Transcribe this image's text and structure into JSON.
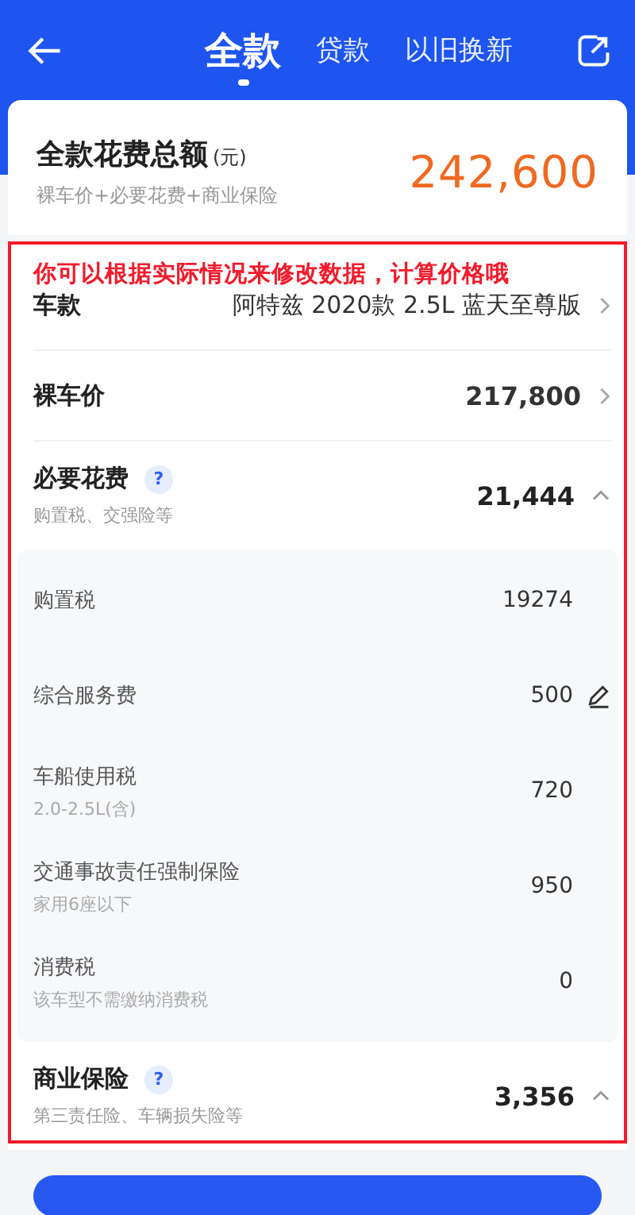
{
  "header": {
    "tabs": [
      {
        "label": "全款",
        "selected": true
      },
      {
        "label": "贷款",
        "selected": false
      },
      {
        "label": "以旧换新",
        "selected": false
      }
    ]
  },
  "summary": {
    "title": "全款花费总额",
    "unit": "(元)",
    "formula": "裸车价+必要花费+商业保险",
    "amount": "242,600"
  },
  "annotation": "你可以根据实际情况来修改数据，计算价格哦",
  "rows": [
    {
      "kind": "link",
      "label": "车款",
      "value": "阿特兹 2020款 2.5L 蓝天至尊版"
    },
    {
      "kind": "link",
      "label": "裸车价",
      "value": "217,800"
    },
    {
      "kind": "group",
      "label": "必要花费",
      "help": "?",
      "note": "购置税、交强险等",
      "value": "21,444",
      "expanded": true,
      "items": [
        {
          "label": "购置税",
          "value": "19274",
          "editable": false
        },
        {
          "label": "综合服务费",
          "value": "500",
          "editable": true
        },
        {
          "label": "车船使用税",
          "note": "2.0-2.5L(含)",
          "value": "720",
          "editable": false
        },
        {
          "label": "交通事故责任强制保险",
          "note": "家用6座以下",
          "value": "950",
          "editable": false
        },
        {
          "label": "消费税",
          "note": "该车型不需缴纳消费税",
          "value": "0",
          "editable": false
        }
      ]
    },
    {
      "kind": "group",
      "label": "商业保险",
      "help": "?",
      "note": "第三责任险、车辆损失险等",
      "value": "3,356",
      "expanded": true
    }
  ]
}
